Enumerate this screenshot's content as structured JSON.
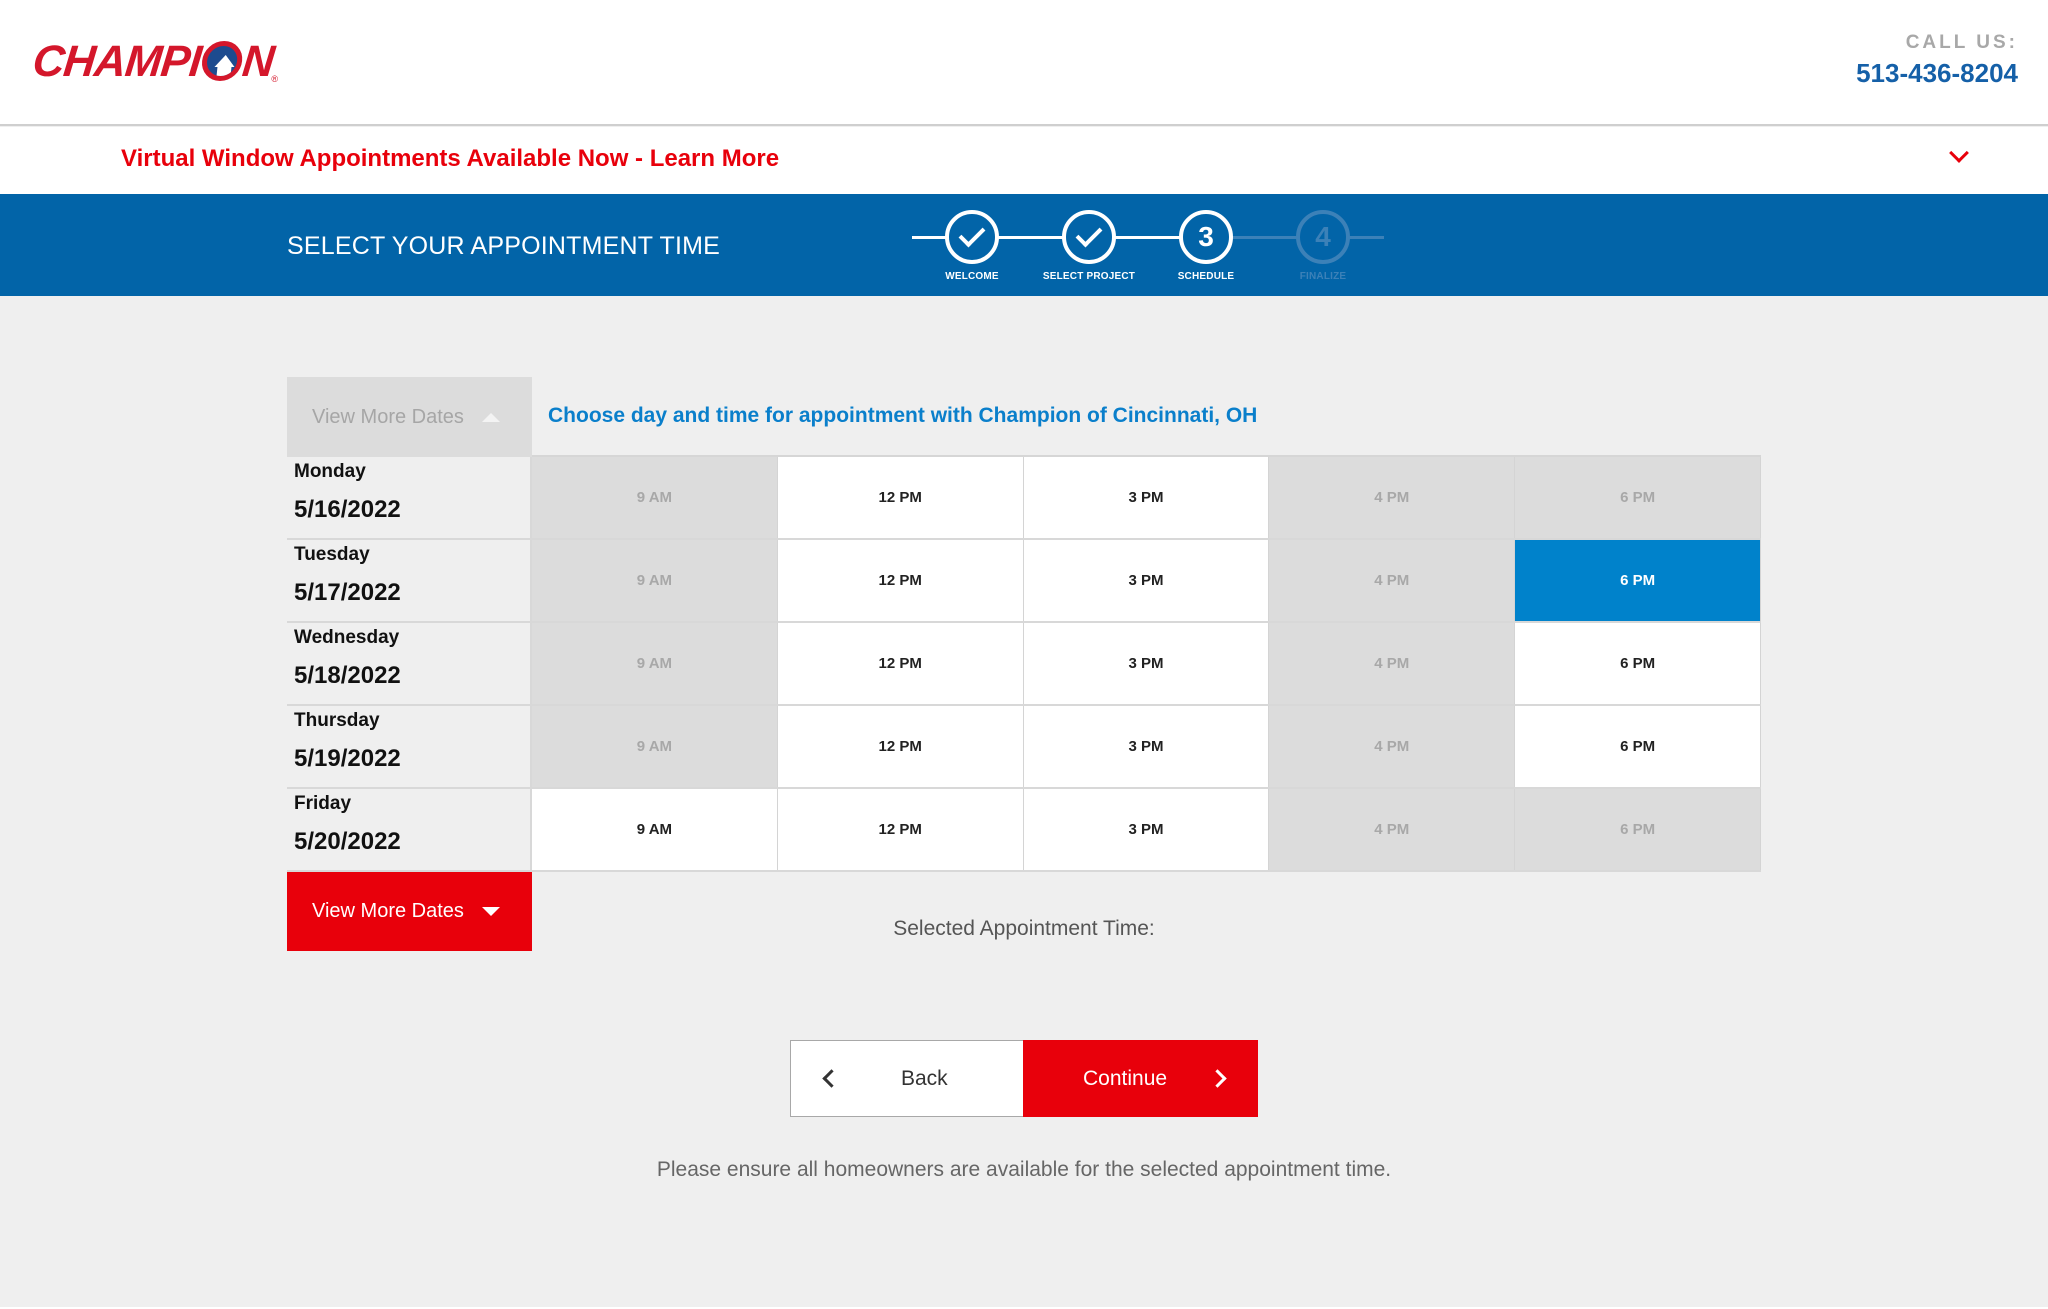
{
  "header": {
    "logo_text_left": "CHAMPI",
    "logo_text_right": "N",
    "logo_reg": "®",
    "call_label": "CALL US:",
    "phone": "513-436-8204"
  },
  "announcement": {
    "text": "Virtual Window Appointments Available Now - Learn More"
  },
  "banner": {
    "title": "SELECT YOUR APPOINTMENT TIME"
  },
  "steps": [
    {
      "number": "1",
      "label": "WELCOME",
      "state": "complete"
    },
    {
      "number": "2",
      "label": "SELECT PROJECT",
      "state": "complete"
    },
    {
      "number": "3",
      "label": "SCHEDULE",
      "state": "current"
    },
    {
      "number": "4",
      "label": "FINALIZE",
      "state": "upcoming"
    }
  ],
  "schedule": {
    "view_more_top": "View More Dates",
    "view_more_bottom": "View More Dates",
    "caption": "Choose day and time for appointment with Champion of Cincinnati, OH",
    "days": [
      {
        "day": "Monday",
        "date": "5/16/2022",
        "slots": [
          {
            "time": "9 AM",
            "state": "unavailable"
          },
          {
            "time": "12 PM",
            "state": "available"
          },
          {
            "time": "3 PM",
            "state": "available"
          },
          {
            "time": "4 PM",
            "state": "unavailable"
          },
          {
            "time": "6 PM",
            "state": "unavailable"
          }
        ]
      },
      {
        "day": "Tuesday",
        "date": "5/17/2022",
        "slots": [
          {
            "time": "9 AM",
            "state": "unavailable"
          },
          {
            "time": "12 PM",
            "state": "available"
          },
          {
            "time": "3 PM",
            "state": "available"
          },
          {
            "time": "4 PM",
            "state": "unavailable"
          },
          {
            "time": "6 PM",
            "state": "selected"
          }
        ]
      },
      {
        "day": "Wednesday",
        "date": "5/18/2022",
        "slots": [
          {
            "time": "9 AM",
            "state": "unavailable"
          },
          {
            "time": "12 PM",
            "state": "available"
          },
          {
            "time": "3 PM",
            "state": "available"
          },
          {
            "time": "4 PM",
            "state": "unavailable"
          },
          {
            "time": "6 PM",
            "state": "available"
          }
        ]
      },
      {
        "day": "Thursday",
        "date": "5/19/2022",
        "slots": [
          {
            "time": "9 AM",
            "state": "unavailable"
          },
          {
            "time": "12 PM",
            "state": "available"
          },
          {
            "time": "3 PM",
            "state": "available"
          },
          {
            "time": "4 PM",
            "state": "unavailable"
          },
          {
            "time": "6 PM",
            "state": "available"
          }
        ]
      },
      {
        "day": "Friday",
        "date": "5/20/2022",
        "slots": [
          {
            "time": "9 AM",
            "state": "available"
          },
          {
            "time": "12 PM",
            "state": "available"
          },
          {
            "time": "3 PM",
            "state": "available"
          },
          {
            "time": "4 PM",
            "state": "unavailable"
          },
          {
            "time": "6 PM",
            "state": "unavailable"
          }
        ]
      }
    ],
    "selected_label": "Selected Appointment Time:"
  },
  "actions": {
    "back": "Back",
    "continue": "Continue"
  },
  "notice": "Please ensure all homeowners are available for the selected appointment time.",
  "colors": {
    "brand_red": "#e8000b",
    "brand_blue": "#0264a8",
    "selected_blue": "#0082cb",
    "caption_blue": "#0a7fcb"
  }
}
